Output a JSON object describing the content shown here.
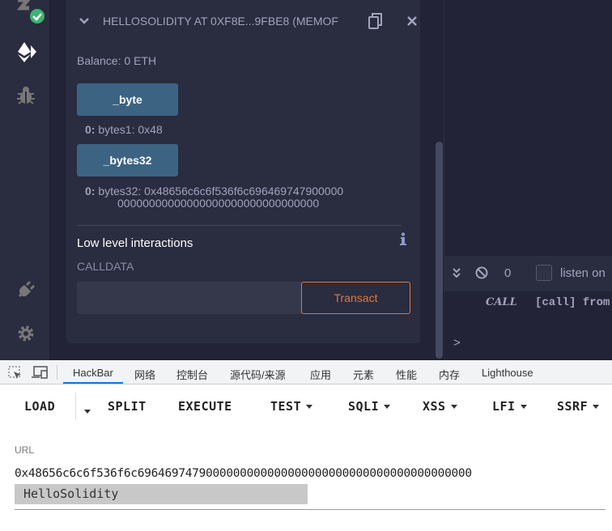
{
  "contract": {
    "title": "HELLOSOLIDITY AT 0XF8E...9FBE8 (MEMOF",
    "balance": "Balance: 0 ETH",
    "functions": [
      {
        "label": "_byte",
        "result_index": "0:",
        "result": "bytes1: 0x48"
      },
      {
        "label": "_bytes32",
        "result_index": "0:",
        "result": "bytes32: 0x48656c6c6f536f6c696469747900000",
        "result_cont": "00000000000000000000000000000000"
      }
    ],
    "low_level_title": "Low level interactions",
    "calldata_label": "CALLDATA",
    "calldata_value": "",
    "transact_label": "Transact"
  },
  "terminal": {
    "count": "0",
    "listen_label": "listen on",
    "log_tag": "CALL",
    "log_text": "[call] from",
    "prompt": ">"
  },
  "devtools": {
    "tabs": [
      "HackBar",
      "网络",
      "控制台",
      "源代码/来源",
      "应用",
      "元素",
      "性能",
      "内存",
      "Lighthouse"
    ],
    "active_tab": "HackBar"
  },
  "hackbar": {
    "buttons": [
      "LOAD",
      "SPLIT",
      "EXECUTE",
      "TEST",
      "SQLI",
      "XSS",
      "LFI",
      "SSRF"
    ],
    "url_label": "URL",
    "url_value": "0x48656c6c6f536f6c6964697479000000000000000000000000000000000000000",
    "decoded": "HelloSolidity"
  },
  "colors": {
    "accent": "#3c6482",
    "transact": "#e0783a",
    "success": "#3cb371"
  }
}
